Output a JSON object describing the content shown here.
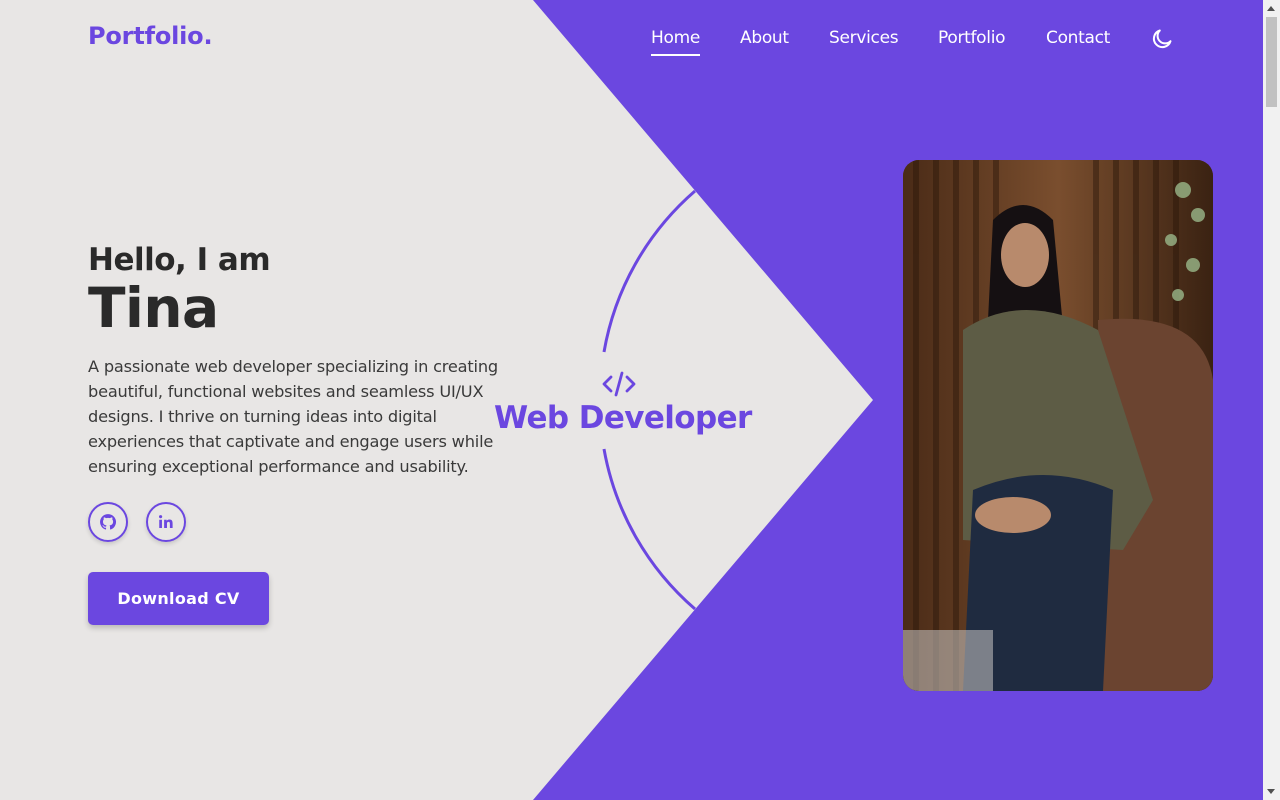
{
  "nav": {
    "logo": "Portfolio.",
    "links": [
      "Home",
      "About",
      "Services",
      "Portfolio",
      "Contact"
    ],
    "active_link": "Home",
    "theme_toggle_icon": "moon-icon"
  },
  "hero": {
    "greeting": "Hello, I am",
    "name": "Tina",
    "description": "A passionate web developer specializing in creating beautiful, functional websites and seamless UI/UX designs. I thrive on turning ideas into digital experiences that captivate and engage users while ensuring exceptional performance and usability.",
    "social_icons": [
      "github-icon",
      "linkedin-icon"
    ],
    "download_label": "Download CV",
    "role_icon": "code-icon",
    "role_label": "Web Developer",
    "profile_photo_icon": "profile-photo"
  },
  "colors": {
    "accent": "#6b47e0",
    "background": "#e8e6e5",
    "text_dark": "#2a2a2a",
    "text_body": "#3a3a3a",
    "nav_text": "#ffffff"
  }
}
